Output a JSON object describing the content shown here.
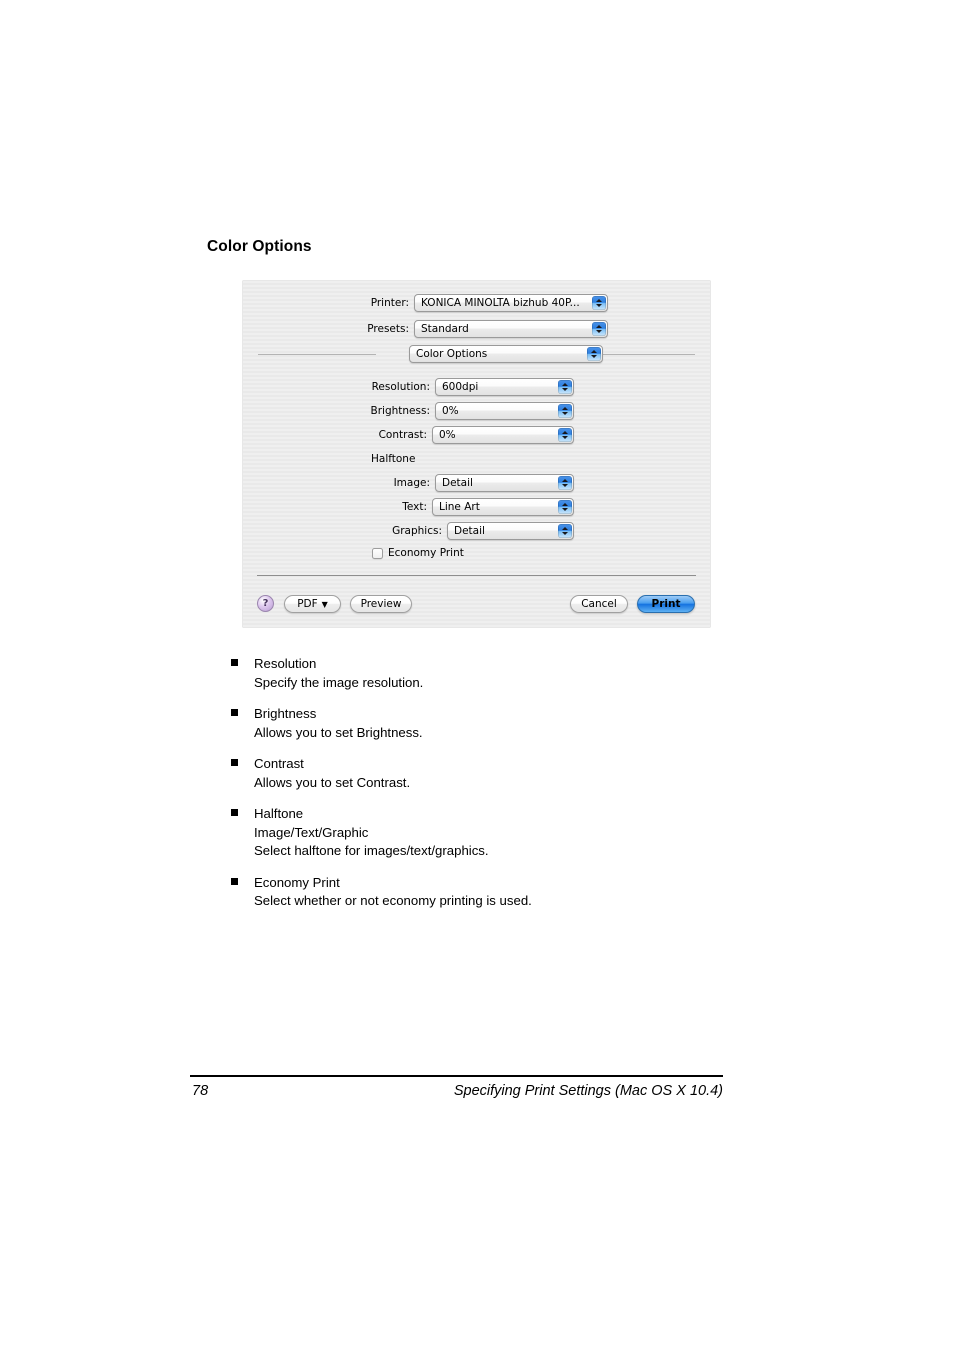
{
  "page": {
    "heading": "Color Options"
  },
  "dialog": {
    "printer": {
      "label": "Printer:",
      "value": "KONICA MINOLTA bizhub 40P..."
    },
    "presets": {
      "label": "Presets:",
      "value": "Standard"
    },
    "panel": {
      "value": "Color Options"
    },
    "resolution": {
      "label": "Resolution:",
      "value": "600dpi"
    },
    "brightness": {
      "label": "Brightness:",
      "value": "0%"
    },
    "contrast": {
      "label": "Contrast:",
      "value": "0%"
    },
    "halftone": {
      "group_label": "Halftone",
      "image": {
        "label": "Image:",
        "value": "Detail"
      },
      "text": {
        "label": "Text:",
        "value": "Line Art"
      },
      "graphics": {
        "label": "Graphics:",
        "value": "Detail"
      }
    },
    "economy_print": {
      "label": "Economy Print",
      "checked": false
    },
    "buttons": {
      "help": "?",
      "pdf": "PDF",
      "pdf_caret": "▼",
      "preview": "Preview",
      "cancel": "Cancel",
      "print": "Print"
    },
    "accent_color": "#1572e0"
  },
  "bullets": [
    {
      "title": "Resolution",
      "lines": [
        "Specify the image resolution."
      ]
    },
    {
      "title": "Brightness",
      "lines": [
        "Allows you to set Brightness."
      ]
    },
    {
      "title": "Contrast",
      "lines": [
        "Allows you to set Contrast."
      ]
    },
    {
      "title": "Halftone",
      "lines": [
        "Image/Text/Graphic",
        "Select halftone for images/text/graphics."
      ]
    },
    {
      "title": "Economy Print",
      "lines": [
        "Select whether or not economy printing is used."
      ]
    }
  ],
  "footer": {
    "page_number": "78",
    "title": "Specifying Print Settings (Mac OS X 10.4)"
  }
}
